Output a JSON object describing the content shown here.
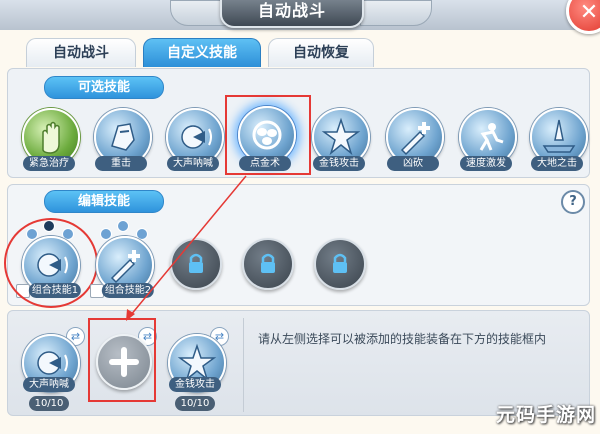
{
  "header": {
    "title": "自动战斗",
    "close_icon": "close-icon"
  },
  "tabs": [
    {
      "label": "自动战斗",
      "active": false
    },
    {
      "label": "自定义技能",
      "active": true
    },
    {
      "label": "自动恢复",
      "active": false
    }
  ],
  "available": {
    "section_label": "可选技能",
    "skills": [
      {
        "label": "紧急治疗",
        "icon": "hand-icon"
      },
      {
        "label": "重击",
        "icon": "knight-head-icon"
      },
      {
        "label": "大声呐喊",
        "icon": "shout-icon"
      },
      {
        "label": "点金术",
        "icon": "coin-swirl-icon"
      },
      {
        "label": "金钱攻击",
        "icon": "coin-burst-icon"
      },
      {
        "label": "凶砍",
        "icon": "sword-plus-icon"
      },
      {
        "label": "速度激发",
        "icon": "runner-icon"
      },
      {
        "label": "大地之击",
        "icon": "ground-sword-icon"
      }
    ]
  },
  "edit": {
    "section_label": "编辑技能",
    "combos": [
      {
        "label": "组合技能1",
        "icon": "shout-icon"
      },
      {
        "label": "组合技能2",
        "icon": "sword-plus-icon"
      }
    ],
    "locked_slots": 3
  },
  "loadout": {
    "slots": [
      {
        "label": "大声呐喊",
        "count": "10/10",
        "icon": "shout-icon"
      },
      {
        "label": "",
        "count": "",
        "icon": "plus-icon"
      },
      {
        "label": "金钱攻击",
        "count": "10/10",
        "icon": "coin-burst-icon"
      }
    ],
    "hint": "请从左侧选择可以被添加的技能装备在下方的技能框内"
  },
  "help_label": "?",
  "watermark": "元码手游网",
  "colors": {
    "accent": "#2f93dc",
    "highlight": "#e53935"
  }
}
